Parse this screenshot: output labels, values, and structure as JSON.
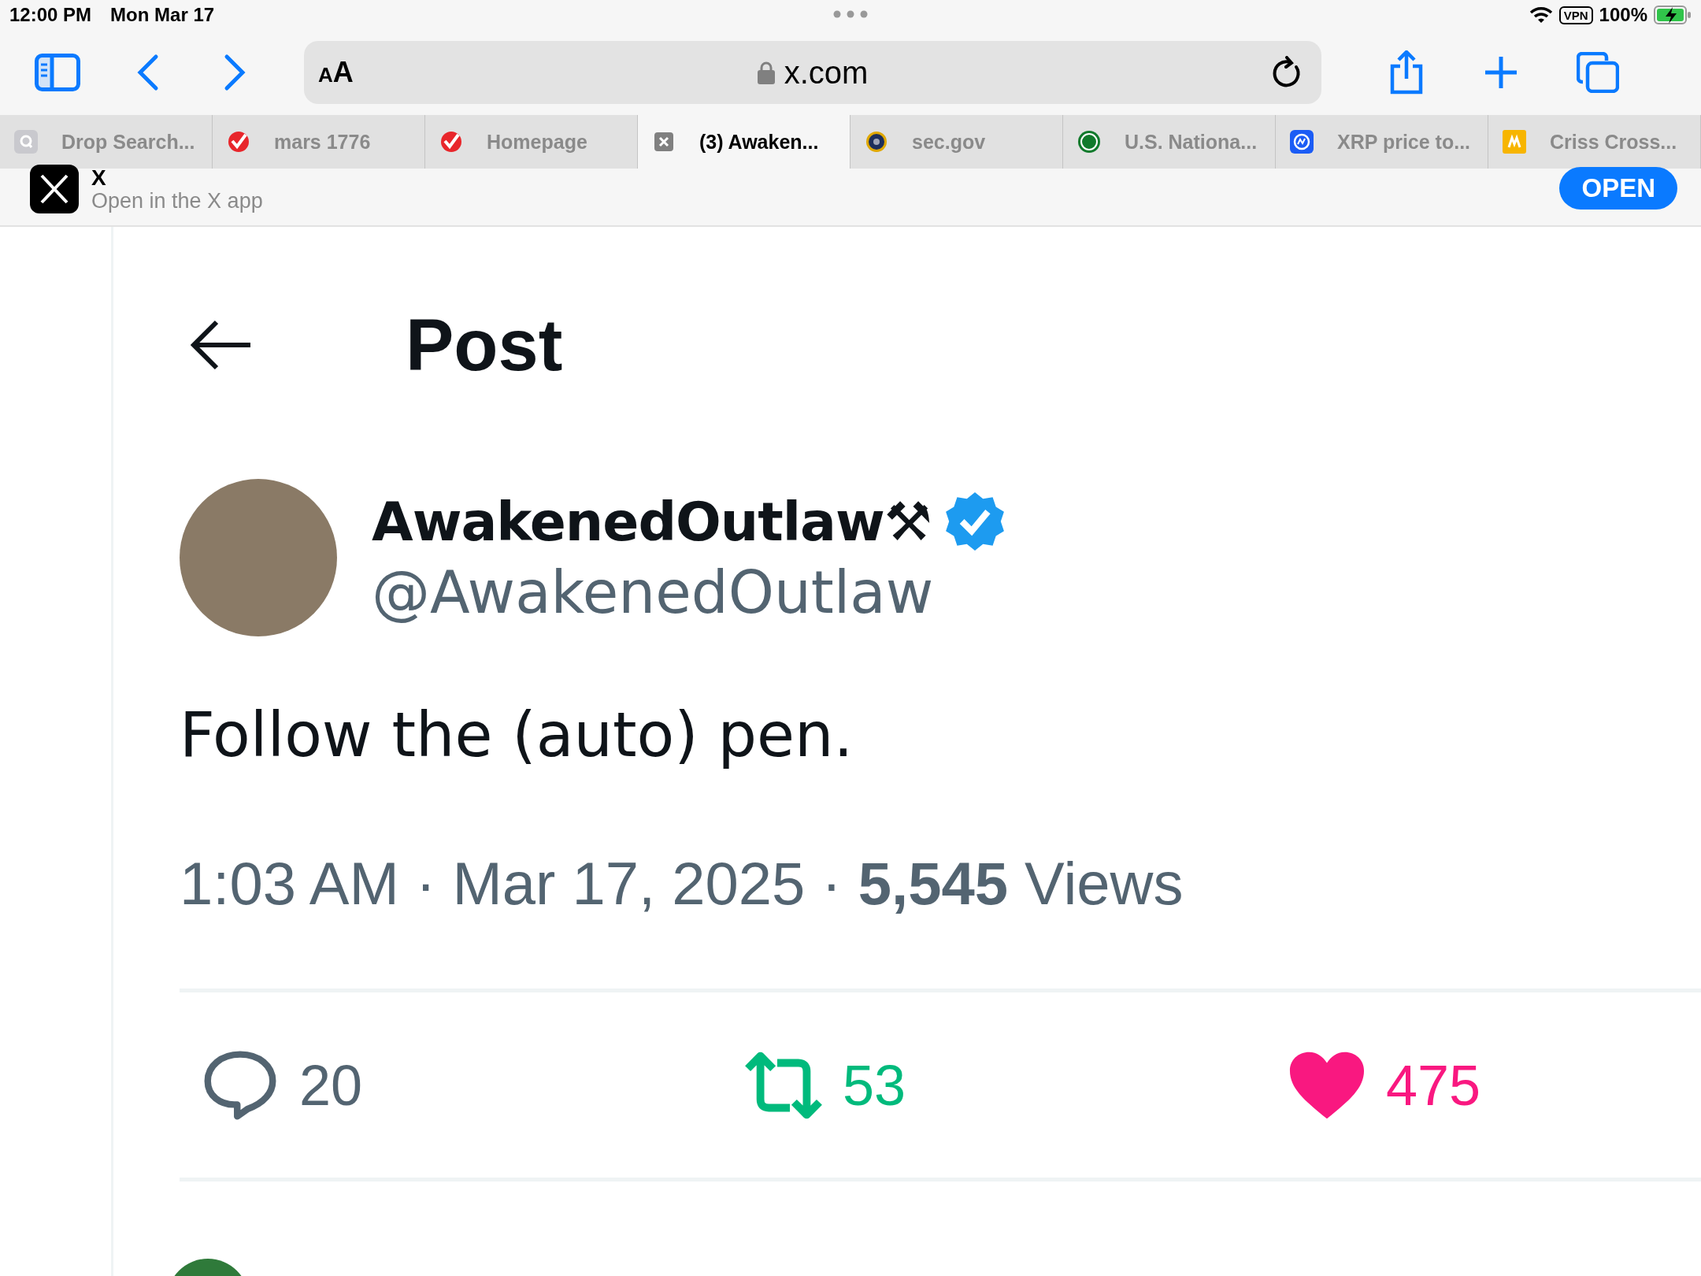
{
  "status_bar": {
    "time": "12:00 PM",
    "date": "Mon Mar 17",
    "vpn": "VPN",
    "battery": "100%"
  },
  "toolbar": {
    "reader_button": "AA",
    "url": "x.com"
  },
  "tabs": [
    {
      "kind": "letter",
      "label": "Drop Search...",
      "selected": false
    },
    {
      "kind": "check",
      "label": "mars 1776",
      "selected": false
    },
    {
      "kind": "check",
      "label": "Homepage",
      "selected": false
    },
    {
      "kind": "close",
      "label": "(3) Awaken...",
      "selected": true
    },
    {
      "kind": "seal",
      "label": "sec.gov",
      "selected": false
    },
    {
      "kind": "badge",
      "label": "U.S. Nationa...",
      "selected": false
    },
    {
      "kind": "logo",
      "label": "XRP price to...",
      "selected": false
    },
    {
      "kind": "tile",
      "label": "Criss Cross...",
      "selected": false
    }
  ],
  "app_banner": {
    "title": "X",
    "subtitle": "Open in the X app",
    "button": "OPEN"
  },
  "header": {
    "title": "Post"
  },
  "post": {
    "name": "AwakenedOutlaw⚒",
    "verified": true,
    "handle": "@AwakenedOutlaw",
    "text": "Follow the (auto) pen.",
    "meta": "1:03 AM · Mar 17, 2025 · **5,545** Views",
    "actions": [
      {
        "kind": "reply",
        "count": "20"
      },
      {
        "kind": "repost",
        "count": "53"
      },
      {
        "kind": "like",
        "count": "475"
      }
    ]
  }
}
